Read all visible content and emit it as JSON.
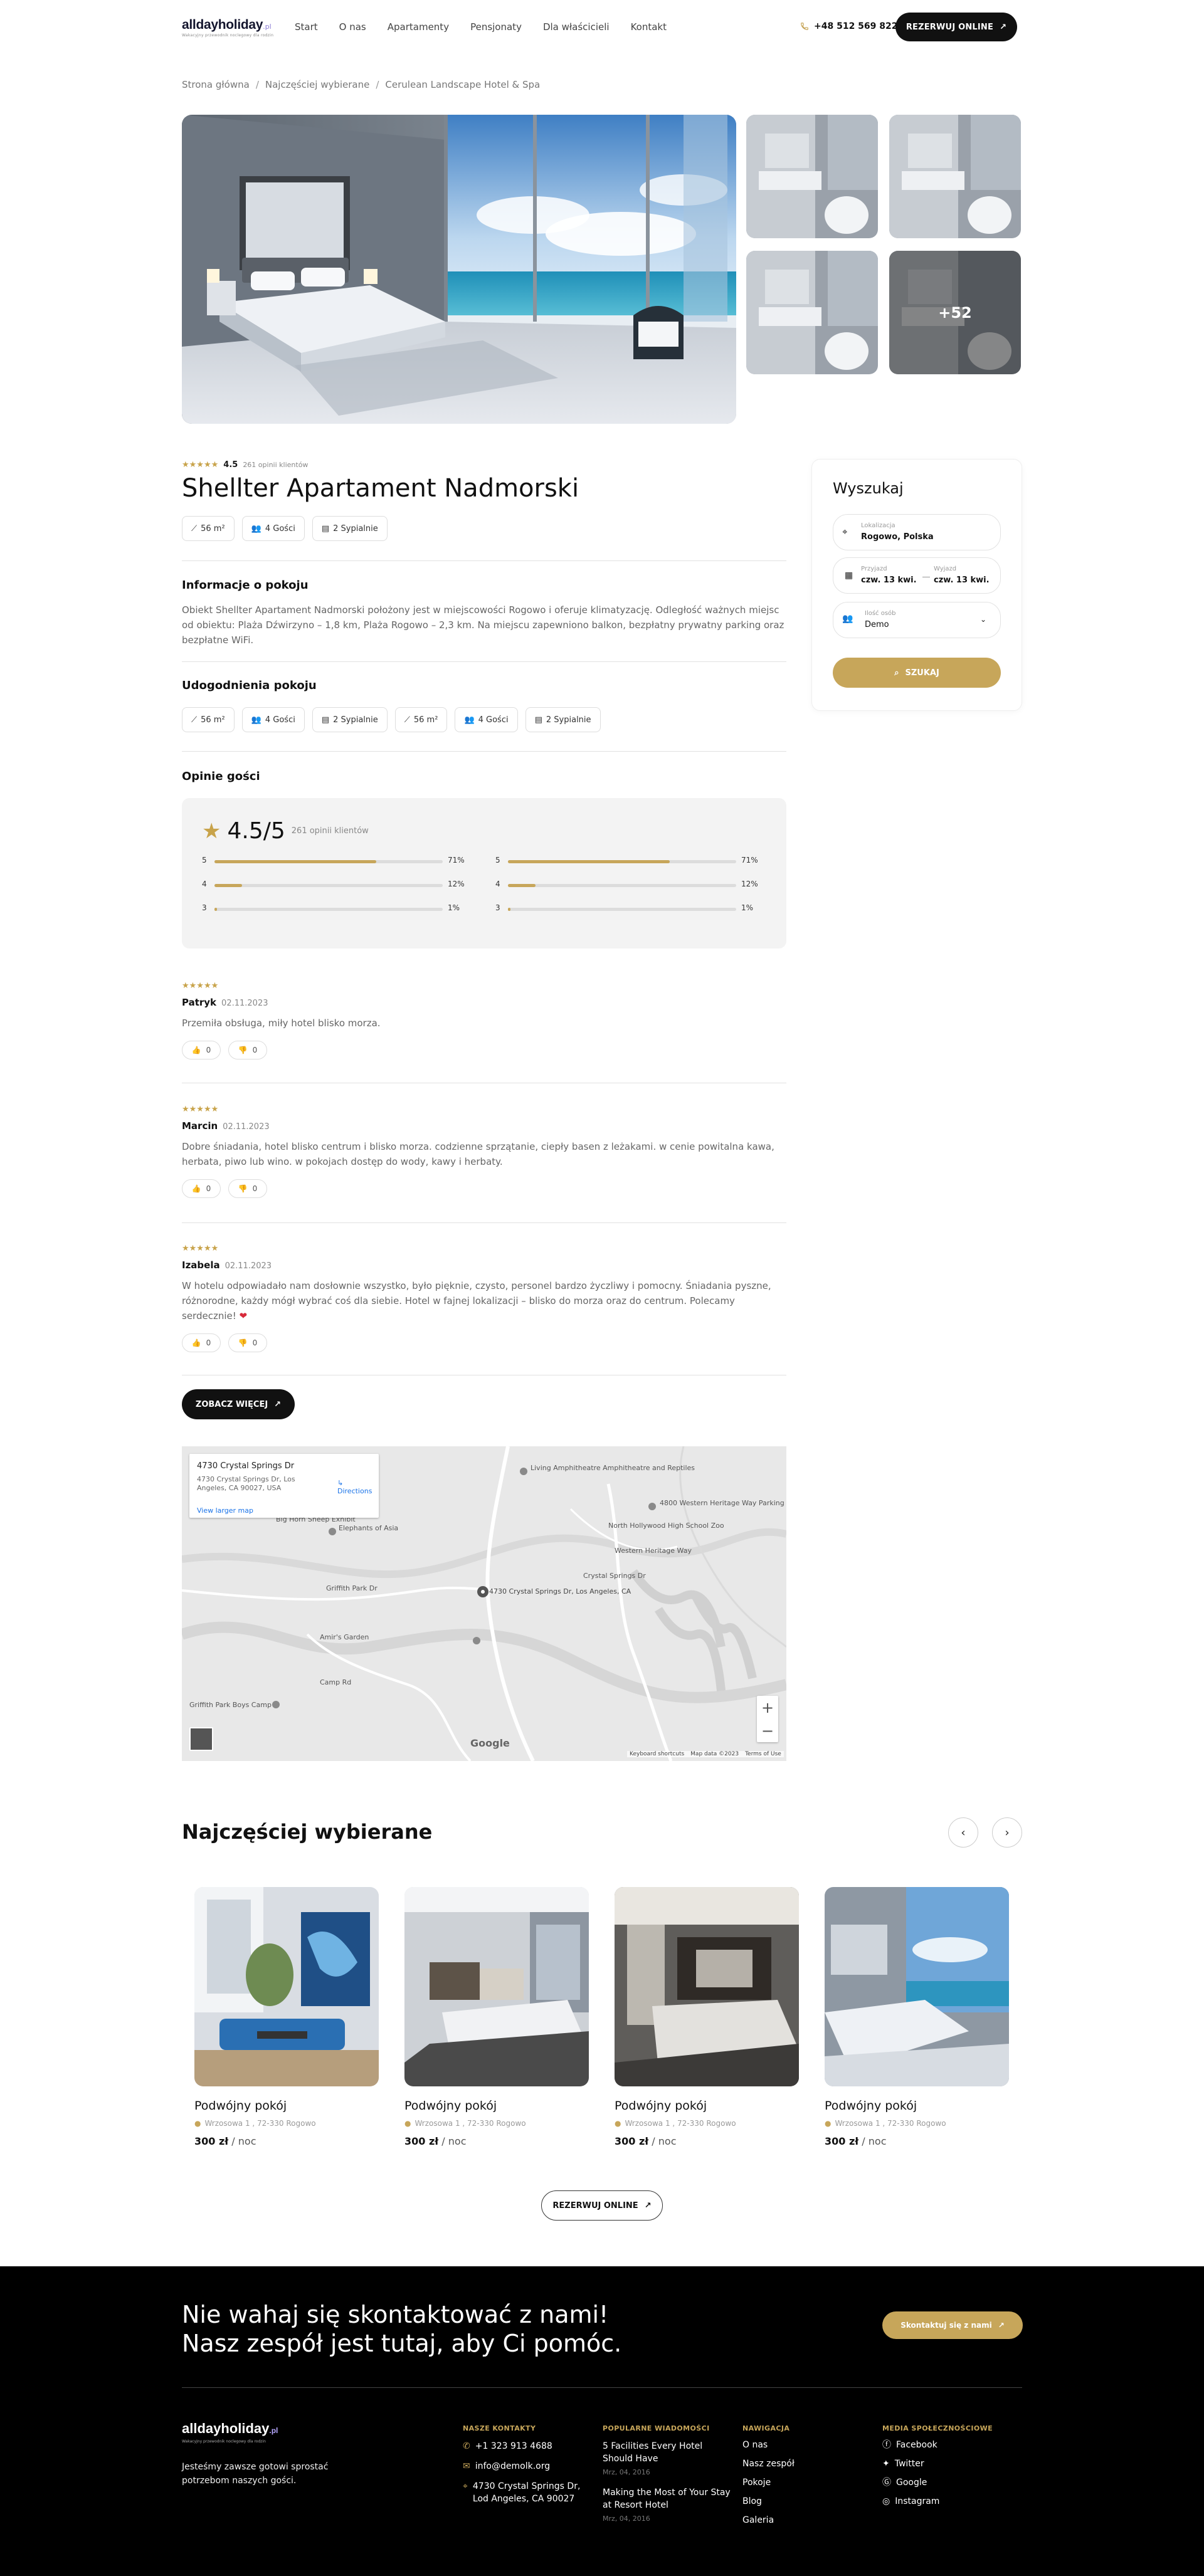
{
  "header": {
    "logo": "alldayholiday",
    "logo_suffix": ".pl",
    "logo_tagline": "Wakacyjny przewodnik noclegowy dla rodzin",
    "nav": [
      "Start",
      "O nas",
      "Apartamenty",
      "Pensjonaty",
      "Dla właścicieli",
      "Kontakt"
    ],
    "phone": "+48 512 569 822",
    "book_button": "REZERWUJ ONLINE"
  },
  "breadcrumb": [
    "Strona główna",
    "Najczęściej wybierane",
    "Cerulean Landscape Hotel & Spa"
  ],
  "gallery": {
    "more_label": "+52"
  },
  "listing": {
    "score": "4.5",
    "reviews_count": "261 opinii klientów",
    "title": "Shellter Apartament Nadmorski",
    "chips": [
      "56 m²",
      "4 Gości",
      "2 Sypialnie"
    ],
    "info_title": "Informacje o pokoju",
    "description": "Obiekt Shellter Apartament Nadmorski położony jest w miejscowości Rogowo i oferuje klimatyzację. Odległość ważnych miejsc od obiektu: Plaża Dźwirzyno – 1,8 km, Plaża Rogowo – 2,3 km. Na miejscu zapewniono balkon, bezpłatny prywatny parking oraz bezpłatne WiFi.",
    "amenities_title": "Udogodnienia pokoju",
    "amenities": [
      "56 m²",
      "4 Gości",
      "2 Sypialnie",
      "56 m²",
      "4 Gości",
      "2 Sypialnie"
    ],
    "reviews_title": "Opinie gości"
  },
  "rating_summary": {
    "score": "4.5/5",
    "count": "261 opinii klientów",
    "bars_left": [
      {
        "label": "5",
        "fraction": 0.71,
        "pct": "71%"
      },
      {
        "label": "4",
        "fraction": 0.12,
        "pct": "12%"
      },
      {
        "label": "3",
        "fraction": 0.01,
        "pct": "1%"
      }
    ],
    "bars_right": [
      {
        "label": "5",
        "fraction": 0.71,
        "pct": "71%"
      },
      {
        "label": "4",
        "fraction": 0.12,
        "pct": "12%"
      },
      {
        "label": "3",
        "fraction": 0.01,
        "pct": "1%"
      }
    ]
  },
  "reviews": [
    {
      "name": "Patryk",
      "date": "02.11.2023",
      "text": "Przemiła obsługa, miły hotel blisko morza.",
      "likes": "0",
      "dislikes": "0"
    },
    {
      "name": "Marcin",
      "date": "02.11.2023",
      "text": "Dobre śniadania, hotel blisko centrum i blisko morza. codzienne sprzątanie, ciepły basen z leżakami. w cenie powitalna kawa, herbata, piwo lub wino. w pokojach dostęp do wody, kawy i herbaty.",
      "likes": "0",
      "dislikes": "0"
    },
    {
      "name": "Izabela",
      "date": "02.11.2023",
      "text": "W hotelu odpowiadało nam dosłownie wszystko, było pięknie, czysto, personel bardzo życzliwy i pomocny. Śniadania pyszne, różnorodne, każdy mógł wybrać coś dla siebie. Hotel w fajnej lokalizacji – blisko do morza oraz do centrum. Polecamy serdecznie!",
      "likes": "0",
      "dislikes": "0"
    }
  ],
  "see_more_button": "ZOBACZ WIĘCEJ",
  "map": {
    "place_title": "4730 Crystal Springs Dr",
    "place_address": "4730 Crystal Springs Dr, Los Angeles, CA 90027, USA",
    "larger_map": "View larger map",
    "directions": "Directions",
    "pin_label": "4730 Crystal Springs Dr, Los Angeles, CA",
    "labels": [
      "Living Amphitheatre Amphitheatre and Reptiles",
      "4800 Western Heritage Way Parking",
      "North Hollywood High School Zoo",
      "Elephants of Asia",
      "Big Horn Sheep Exhibit",
      "Crystal Springs Dr",
      "Amir's Garden",
      "Griffith Park Dr",
      "Camp Rd",
      "Griffith Park Boys Camp",
      "Western Heritage Way"
    ],
    "footer": [
      "Keyboard shortcuts",
      "Map data ©2023",
      "Terms of Use"
    ],
    "google": "Google",
    "zoom_in": "+",
    "zoom_out": "−"
  },
  "popular": {
    "title": "Najczęściej wybierane",
    "cards": [
      {
        "title": "Podwójny pokój",
        "address": "Wrzosowa 1 , 72-330 Rogowo",
        "price": "300 zł",
        "unit": " / noc"
      },
      {
        "title": "Podwójny pokój",
        "address": "Wrzosowa 1 , 72-330 Rogowo",
        "price": "300 zł",
        "unit": " / noc"
      },
      {
        "title": "Podwójny pokój",
        "address": "Wrzosowa 1 , 72-330 Rogowo",
        "price": "300 zł",
        "unit": " / noc"
      },
      {
        "title": "Podwójny pokój",
        "address": "Wrzosowa 1 , 72-330 Rogowo",
        "price": "300 zł",
        "unit": " / noc"
      }
    ],
    "book_button": "REZERWUJ ONLINE"
  },
  "search": {
    "title": "Wyszukaj",
    "location_label": "Lokalizacja",
    "location_value": "Rogowo, Polska",
    "checkin_label": "Przyjazd",
    "checkin_value": "czw. 13 kwi.",
    "checkout_label": "Wyjazd",
    "checkout_value": "czw. 13 kwi.",
    "guests_label": "Ilość osób",
    "guests_value": "Demo",
    "button": "SZUKAJ"
  },
  "footer": {
    "cta_line1": "Nie wahaj się skontaktować z nami!",
    "cta_line2": "Nasz zespół jest tutaj, aby Ci pomóc.",
    "contact_button": "Skontaktuj się z nami",
    "logo": "alldayholiday",
    "logo_suffix": ".pl",
    "tagline": "Wakacyjny przewodnik noclegowy dla rodzin",
    "description": "Jesteśmy zawsze gotowi sprostać potrzebom naszych gości.",
    "contact_title": "NASZE KONTAKTY",
    "phone": "+1 323 913 4688",
    "email": "info@demolk.org",
    "address": "4730 Crystal Springs Dr, Lod Angeles, CA 90027",
    "news_title": "POPULARNE WIADOMOŚCI",
    "news": [
      {
        "title": "5 Facilities Every Hotel Should Have",
        "date": "Mrz, 04, 2016"
      },
      {
        "title": "Making the Most of Your Stay at Resort Hotel",
        "date": "Mrz, 04, 2016"
      }
    ],
    "nav_title": "NAWIGACJA",
    "nav": [
      "O nas",
      "Nasz zespół",
      "Pokoje",
      "Blog",
      "Galeria"
    ],
    "social_title": "MEDIA SPOŁECZNOŚCIOWE",
    "social": [
      "Facebook",
      "Twitter",
      "Google",
      "Instagram"
    ]
  }
}
